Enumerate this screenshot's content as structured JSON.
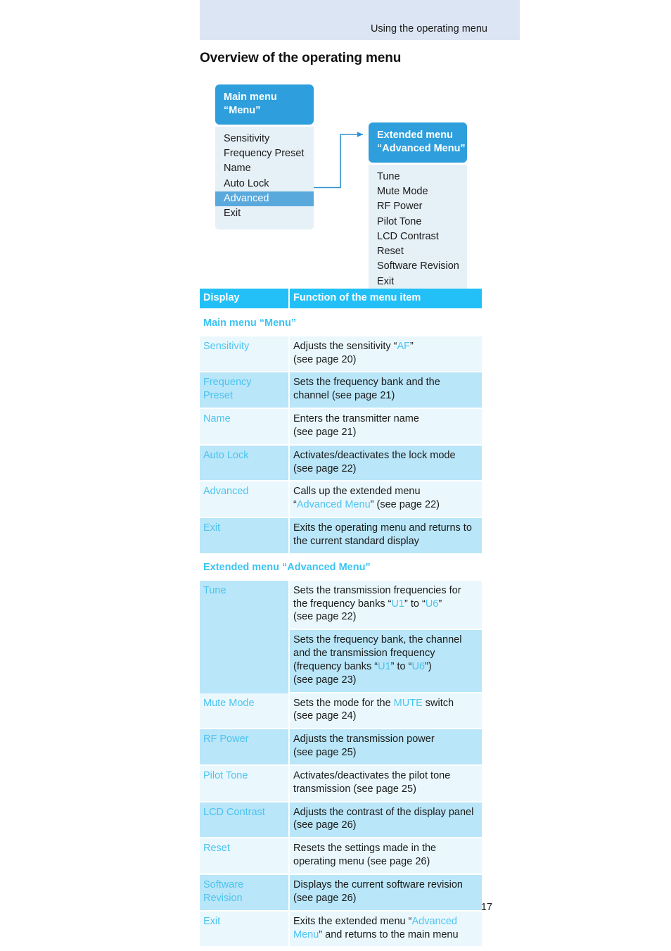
{
  "running_header": {
    "text": "Using the operating menu"
  },
  "page_title": "Overview of the operating menu",
  "folio": "17",
  "colors": {
    "header_band": "#dce5f3",
    "box_header": "#2e9fdc",
    "box_body": "#e6f0f7",
    "selected_item": "#5aa9dd",
    "table_header": "#22c0f7",
    "row_light": "#eaf8fd",
    "row_dark": "#b9e6f8",
    "accent_text": "#4cc3f0"
  },
  "diagram": {
    "main_menu": {
      "title_line1": "Main menu",
      "title_line2": "“Menu”",
      "items": [
        {
          "label": "Sensitivity",
          "selected": false
        },
        {
          "label": "Frequency Preset",
          "selected": false
        },
        {
          "label": "Name",
          "selected": false
        },
        {
          "label": "Auto Lock",
          "selected": false
        },
        {
          "label": "Advanced",
          "selected": true
        },
        {
          "label": "Exit",
          "selected": false
        }
      ]
    },
    "advanced_menu": {
      "title_line1": "Extended menu",
      "title_line2": "“Advanced Menu”",
      "items": [
        {
          "label": "Tune",
          "selected": false
        },
        {
          "label": "Mute Mode",
          "selected": false
        },
        {
          "label": "RF Power",
          "selected": false
        },
        {
          "label": "Pilot Tone",
          "selected": false
        },
        {
          "label": "LCD Contrast",
          "selected": false
        },
        {
          "label": "Reset",
          "selected": false
        },
        {
          "label": "Software Revision",
          "selected": false
        },
        {
          "label": "Exit",
          "selected": false
        }
      ]
    },
    "connector_label": "Advanced opens Extended menu"
  },
  "table": {
    "columns": [
      "Display",
      "Function of the menu item"
    ],
    "sections": [
      {
        "heading": "Main menu “Menu”",
        "rows": [
          {
            "display": "Sensitivity",
            "desc_parts": [
              {
                "t": "Adjusts the sensitivity “",
                "hl": false
              },
              {
                "t": "AF",
                "hl": true
              },
              {
                "t": "”",
                "hl": false
              },
              {
                "t": "\n(see page 20)",
                "hl": false
              }
            ]
          },
          {
            "display": "Frequency Preset",
            "desc_parts": [
              {
                "t": "Sets the frequency bank and the channel (see page 21)",
                "hl": false
              }
            ]
          },
          {
            "display": "Name",
            "desc_parts": [
              {
                "t": "Enters the transmitter name\n(see page 21)",
                "hl": false
              }
            ]
          },
          {
            "display": "Auto Lock",
            "desc_parts": [
              {
                "t": "Activates/deactivates the lock mode\n(see page 22)",
                "hl": false
              }
            ]
          },
          {
            "display": "Advanced",
            "desc_parts": [
              {
                "t": "Calls up the extended menu\n“",
                "hl": false
              },
              {
                "t": "Advanced Menu",
                "hl": true
              },
              {
                "t": "” (see page 22)",
                "hl": false
              }
            ]
          },
          {
            "display": "Exit",
            "desc_parts": [
              {
                "t": "Exits the operating menu and returns to the current standard display",
                "hl": false
              }
            ]
          }
        ]
      },
      {
        "heading": "Extended menu “Advanced Menu”",
        "rows": [
          {
            "display": "Tune",
            "desc_parts": [
              {
                "t": "Sets the transmission frequencies for the frequency banks “",
                "hl": false
              },
              {
                "t": "U1",
                "hl": true
              },
              {
                "t": "” to “",
                "hl": false
              },
              {
                "t": "U6",
                "hl": true
              },
              {
                "t": "”\n(see page 22)",
                "hl": false
              }
            ],
            "desc2_parts": [
              {
                "t": "Sets the frequency bank, the channel and the transmission frequency (frequency banks “",
                "hl": false
              },
              {
                "t": "U1",
                "hl": true
              },
              {
                "t": "” to “",
                "hl": false
              },
              {
                "t": "U6",
                "hl": true
              },
              {
                "t": "”)\n(see page 23)",
                "hl": false
              }
            ]
          },
          {
            "display": "Mute Mode",
            "desc_parts": [
              {
                "t": "Sets the mode for the ",
                "hl": false
              },
              {
                "t": "MUTE",
                "hl": true
              },
              {
                "t": " switch\n(see page 24)",
                "hl": false
              }
            ]
          },
          {
            "display": "RF Power",
            "desc_parts": [
              {
                "t": "Adjusts the transmission power\n(see page 25)",
                "hl": false
              }
            ]
          },
          {
            "display": "Pilot Tone",
            "desc_parts": [
              {
                "t": "Activates/deactivates the pilot tone transmission (see page 25)",
                "hl": false
              }
            ]
          },
          {
            "display": "LCD Contrast",
            "desc_parts": [
              {
                "t": "Adjusts the contrast of the display panel (see page 26)",
                "hl": false
              }
            ]
          },
          {
            "display": "Reset",
            "desc_parts": [
              {
                "t": "Resets the settings made in the operating menu (see page 26)",
                "hl": false
              }
            ]
          },
          {
            "display": "Software Revision",
            "desc_parts": [
              {
                "t": "Displays the current software revision\n(see page 26)",
                "hl": false
              }
            ]
          },
          {
            "display": "Exit",
            "desc_parts": [
              {
                "t": "Exits the extended menu “",
                "hl": false
              },
              {
                "t": "Advanced Menu",
                "hl": true
              },
              {
                "t": "” and returns to the main menu",
                "hl": false
              }
            ]
          }
        ]
      }
    ]
  }
}
